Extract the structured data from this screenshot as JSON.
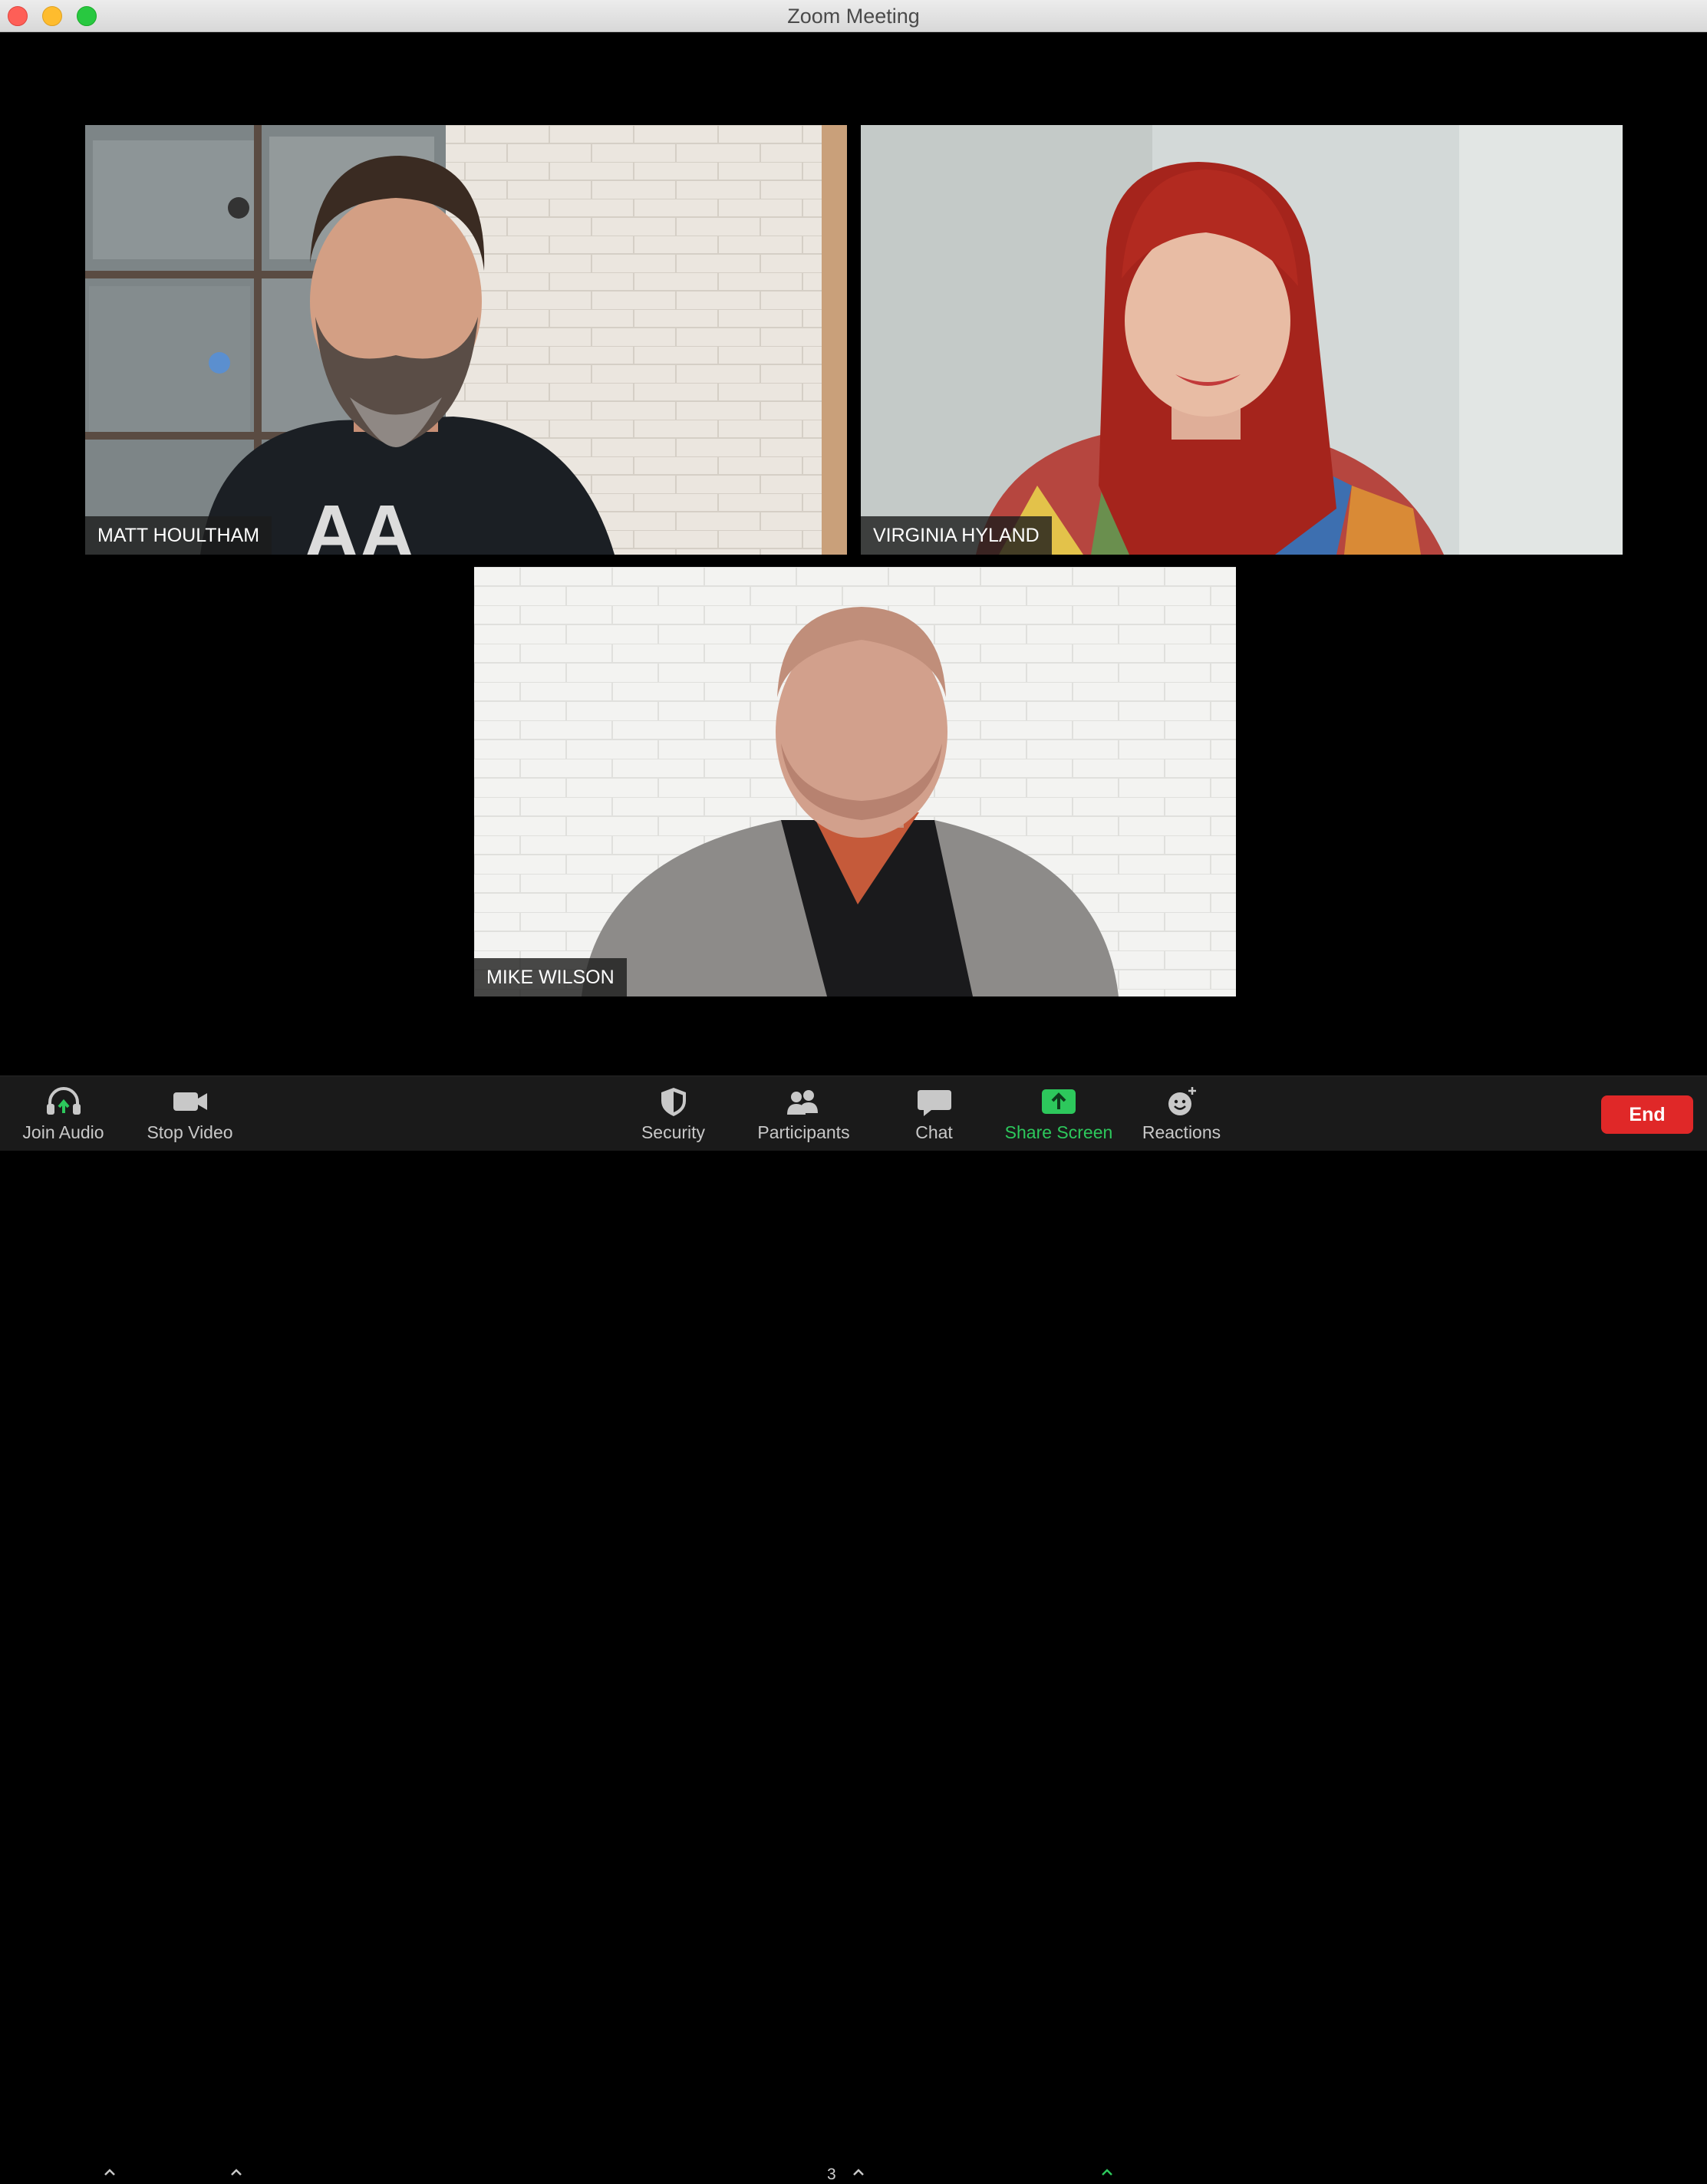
{
  "window": {
    "title": "Zoom Meeting"
  },
  "participants": [
    {
      "name": "MATT HOULTHAM"
    },
    {
      "name": "VIRGINIA HYLAND"
    },
    {
      "name": "MIKE WILSON"
    }
  ],
  "toolbar": {
    "join_audio": "Join Audio",
    "stop_video": "Stop Video",
    "security": "Security",
    "participants": "Participants",
    "participants_count": "3",
    "chat": "Chat",
    "share_screen": "Share Screen",
    "reactions": "Reactions",
    "end": "End"
  },
  "colors": {
    "share_green": "#2dc85c",
    "end_red": "#e02828",
    "toolbar_bg": "#1a1a1a"
  }
}
